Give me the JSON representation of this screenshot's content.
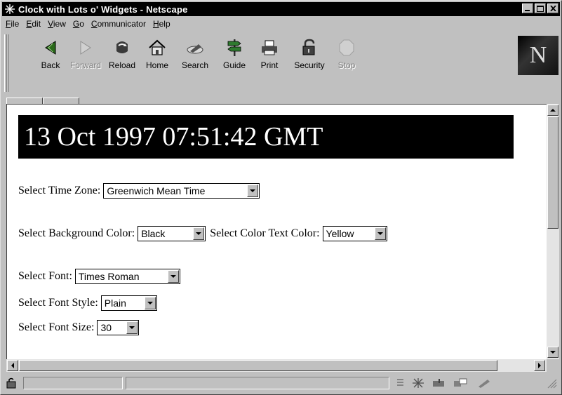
{
  "window": {
    "title": "Clock with Lots o' Widgets - Netscape"
  },
  "menubar": {
    "items": [
      {
        "label": "File",
        "key": "F",
        "rest": "ile"
      },
      {
        "label": "Edit",
        "key": "E",
        "rest": "dit"
      },
      {
        "label": "View",
        "key": "V",
        "rest": "iew"
      },
      {
        "label": "Go",
        "key": "G",
        "rest": "o"
      },
      {
        "label": "Communicator",
        "key": "C",
        "rest": "ommunicator"
      },
      {
        "label": "Help",
        "key": "H",
        "rest": "elp"
      }
    ]
  },
  "toolbar": {
    "back": "Back",
    "forward": "Forward",
    "reload": "Reload",
    "home": "Home",
    "search": "Search",
    "guide": "Guide",
    "print": "Print",
    "security": "Security",
    "stop": "Stop",
    "logo": "N"
  },
  "page": {
    "clock_text": "13 Oct 1997 07:51:42 GMT",
    "time_zone": {
      "label": "Select Time Zone:",
      "value": "Greenwich Mean Time"
    },
    "bg_color": {
      "label": "Select Background Color:",
      "value": "Black"
    },
    "text_color": {
      "label": "Select Color Text Color:",
      "value": "Yellow"
    },
    "font": {
      "label": "Select Font:",
      "value": "Times Roman"
    },
    "font_style": {
      "label": "Select Font Style:",
      "value": "Plain"
    },
    "font_size": {
      "label": "Select Font Size:",
      "value": "30"
    }
  },
  "colors": {
    "titlebar": "#000000",
    "chrome": "#c0c0c0",
    "clock_bg": "#000000",
    "clock_fg": "#ffffff"
  }
}
